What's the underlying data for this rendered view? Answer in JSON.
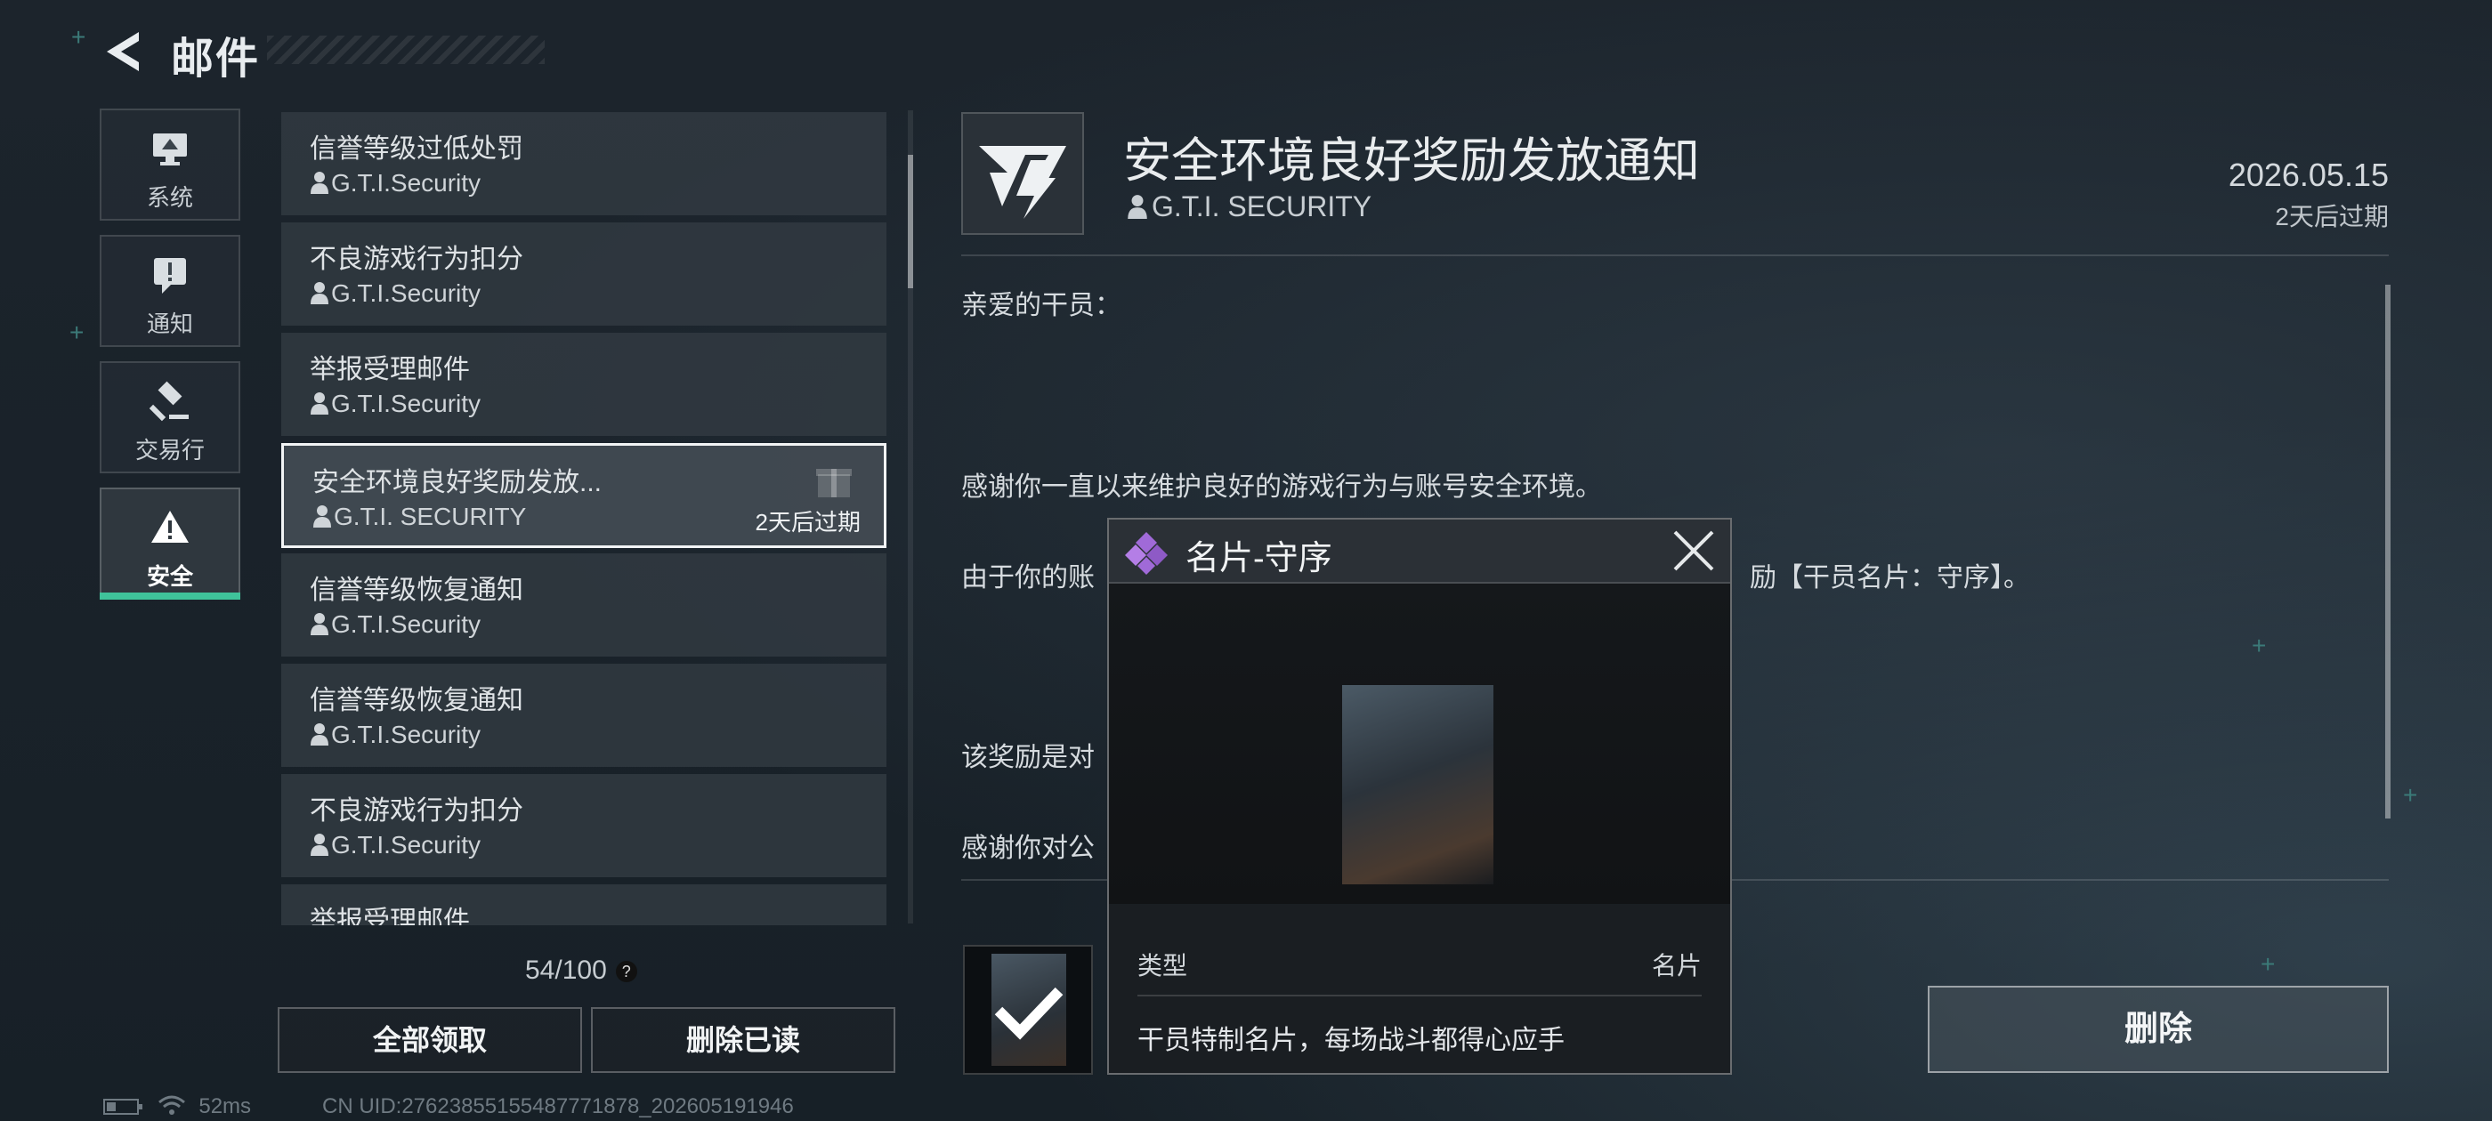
{
  "header": {
    "title": "邮件",
    "back_icon": "back-arrow-icon"
  },
  "categories": [
    {
      "label": "系统",
      "icon": "monitor-icon",
      "active": false
    },
    {
      "label": "通知",
      "icon": "notice-icon",
      "active": false
    },
    {
      "label": "交易行",
      "icon": "gavel-icon",
      "active": false
    },
    {
      "label": "安全",
      "icon": "warning-icon",
      "active": true
    }
  ],
  "mails": [
    {
      "subject": "信誉等级过低处罚",
      "sender": "G.T.I.Security"
    },
    {
      "subject": "不良游戏行为扣分",
      "sender": "G.T.I.Security"
    },
    {
      "subject": "举报受理邮件",
      "sender": "G.T.I.Security"
    },
    {
      "subject": "安全环境良好奖励发放...",
      "sender": "G.T.I. SECURITY",
      "expiry": "2天后过期",
      "selected": true
    },
    {
      "subject": "信誉等级恢复通知",
      "sender": "G.T.I.Security"
    },
    {
      "subject": "信誉等级恢复通知",
      "sender": "G.T.I.Security"
    },
    {
      "subject": "不良游戏行为扣分",
      "sender": "G.T.I.Security"
    },
    {
      "subject": "举报受理邮件",
      "sender": ""
    }
  ],
  "mail_count": "54/100",
  "help_mark": "?",
  "buttons": {
    "claim_all": "全部领取",
    "delete_read": "删除已读",
    "delete": "删除"
  },
  "status": {
    "ping": "52ms",
    "uid": "CN UID:27623855155487771878_202605191946"
  },
  "detail": {
    "title": "安全环境良好奖励发放通知",
    "sender": "G.T.I. SECURITY",
    "date": "2026.05.15",
    "expiry": "2天后过期",
    "greeting": "亲爱的干员：",
    "line1": "感谢你一直以来维护良好的游戏行为与账号安全环境。",
    "line2a": "由于你的账",
    "line2b": "励【干员名片：守序】。",
    "line3": "该奖励是对",
    "line4": "感谢你对公"
  },
  "popup": {
    "title": "名片-守序",
    "type_label": "类型",
    "type_value": "名片",
    "description": "干员特制名片，每场战斗都得心应手"
  },
  "colors": {
    "accent": "#3fc39a",
    "gem": "#a06ad8"
  }
}
